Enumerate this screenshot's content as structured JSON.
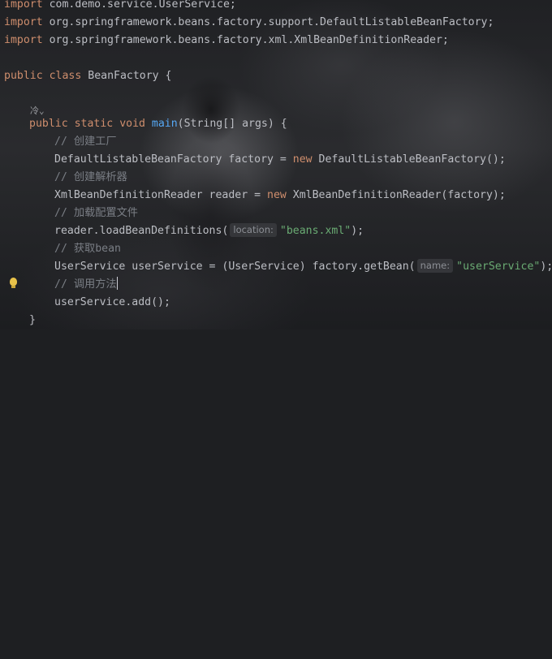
{
  "code": {
    "imports": [
      "com.demo.service.UserService;",
      "org.springframework.beans.factory.support.DefaultListableBeanFactory;",
      "org.springframework.beans.factory.xml.XmlBeanDefinitionReader;"
    ],
    "kw_import": "import",
    "kw_public": "public",
    "kw_class": "class",
    "class_name": "BeanFactory {",
    "gutter_marker": "冷⌄",
    "kw_static": "static",
    "kw_void": "void",
    "method_name": "main",
    "method_params": "(String[] args) {",
    "comment1": "// 创建工厂",
    "line_factory_decl": "DefaultListableBeanFactory factory = ",
    "kw_new": "new",
    "line_factory_ctor": " DefaultListableBeanFactory();",
    "comment2": "// 创建解析器",
    "line_reader_decl": "XmlBeanDefinitionReader reader = ",
    "line_reader_ctor": " XmlBeanDefinitionReader(factory);",
    "comment3": "// 加载配置文件",
    "line_load_call": "reader.loadBeanDefinitions(",
    "hint_location": "location:",
    "str_beans": "\"beans.xml\"",
    "line_end": ");",
    "comment4": "// 获取bean",
    "line_get_decl": "UserService userService = (UserService) factory.getBean(",
    "hint_name": "name:",
    "str_userservice": "\"userService\"",
    "comment5": "// 调用方法",
    "line_add": "userService.add();",
    "close_brace": "}"
  }
}
